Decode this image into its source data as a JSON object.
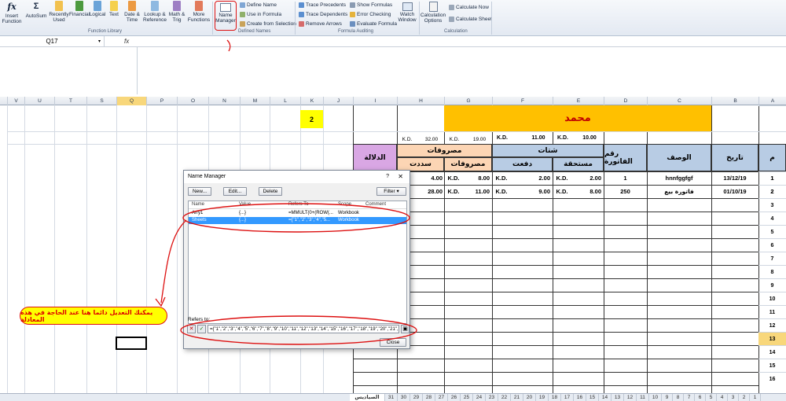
{
  "ribbon": {
    "function_library": {
      "insert_function": "Insert Function",
      "autosum": "AutoSum",
      "recently_used": "Recently Used",
      "financial": "Financial",
      "logical": "Logical",
      "text": "Text",
      "date_time": "Date & Time",
      "lookup": "Lookup & Reference",
      "math": "Math & Trig",
      "more": "More Functions",
      "label": "Function Library"
    },
    "defined_names": {
      "name_manager": "Name Manager",
      "define_name": "Define Name",
      "use_in_formula": "Use in Formula",
      "create_from_selection": "Create from Selection",
      "label": "Defined Names"
    },
    "formula_auditing": {
      "trace_precedents": "Trace Precedents",
      "trace_dependents": "Trace Dependents",
      "remove_arrows": "Remove Arrows",
      "show_formulas": "Show Formulas",
      "error_checking": "Error Checking",
      "evaluate_formula": "Evaluate Formula",
      "watch_window": "Watch Window",
      "label": "Formula Auditing"
    },
    "calculation": {
      "options": "Calculation Options",
      "calc_now": "Calculate Now",
      "calc_sheet": "Calculate Sheet",
      "label": "Calculation"
    }
  },
  "formula_bar": {
    "name_box": "Q17",
    "fx": "fx"
  },
  "columns": [
    "V",
    "U",
    "T",
    "S",
    "Q",
    "P",
    "O",
    "N",
    "M",
    "L",
    "K",
    "J",
    "I",
    "H",
    "G",
    "F",
    "E",
    "D",
    "C",
    "B",
    "A"
  ],
  "rows": [
    "1",
    "2",
    "3",
    "4",
    "5",
    "6",
    "7",
    "8",
    "9",
    "10",
    "11",
    "12",
    "13",
    "14",
    "15",
    "16"
  ],
  "sheet": {
    "k_value": "2",
    "title": "محمد",
    "kd": "K.D.",
    "totals": {
      "h": "32.00",
      "g": "19.00",
      "f": "11.00",
      "e": "10.00"
    },
    "headers": {
      "m": "م",
      "date": "تاريخ",
      "desc": "الوصف",
      "invoice": "رقم الفاتورة",
      "shtat": "شتات",
      "due": "مستحقة",
      "paid": "دفعت",
      "expenses": "مصروفات",
      "exp_sub": "مصروفات",
      "paid2": "سددت",
      "indicator": "الدلالة"
    },
    "data_rows": [
      {
        "m": "1",
        "date": "13/12/19",
        "desc": "hnnfggfgf",
        "invoice": "1",
        "e": "2.00",
        "f": "2.00",
        "g": "8.00",
        "h": "4.00"
      },
      {
        "m": "2",
        "date": "01/10/19",
        "desc": "فاتورة بيع",
        "invoice": "250",
        "e": "8.00",
        "f": "9.00",
        "g": "11.00",
        "h": "28.00"
      }
    ]
  },
  "dialog": {
    "title": "Name Manager",
    "help": "?",
    "close_x": "✕",
    "new": "New...",
    "edit": "Edit...",
    "delete": "Delete",
    "filter": "Filter ▾",
    "col_name": "Name",
    "col_value": "Value",
    "col_refers": "Refers To",
    "col_scope": "Scope",
    "col_comment": "Comment",
    "rows": [
      {
        "name": "Arry1",
        "value": "{...}",
        "refers": "=MMULT(0+(ROW(...",
        "scope": "Workbook"
      },
      {
        "name": "Sheets",
        "value": "{...}",
        "refers": "={\"1\",\"2\",\"3\",\"4\",\"5...",
        "scope": "Workbook"
      }
    ],
    "refers_label": "Refers to:",
    "refers_value": "={\"1\",\"2\",\"3\",\"4\",\"5\",\"6\",\"7\",\"8\",\"9\",\"10\",\"11\",\"12\",\"13\",\"14\",\"15\",\"16\",\"17\",\"18\",\"19\",\"20\",\"21\",\"22\"}",
    "close": "Close"
  },
  "annotation": {
    "callout": "يمكنك التعديل دائما هنا عند الحاجة في هذه المعادلة"
  },
  "tabs": [
    "الصياديس",
    "31",
    "30",
    "29",
    "28",
    "27",
    "26",
    "25",
    "24",
    "23",
    "22",
    "21",
    "20",
    "19",
    "18",
    "17",
    "16",
    "15",
    "14",
    "13",
    "12",
    "11",
    "10",
    "9",
    "8",
    "7",
    "6",
    "5",
    "4",
    "3",
    "2",
    "1"
  ],
  "colors": {
    "title_fill": "#ffc000",
    "yellow": "#ffff00",
    "header_blue": "#b8cce4",
    "header_orange": "#fcd5b4",
    "header_purple": "#d9a7e4",
    "selected_row": "#3399ff",
    "annotation_red": "#dd1111"
  }
}
